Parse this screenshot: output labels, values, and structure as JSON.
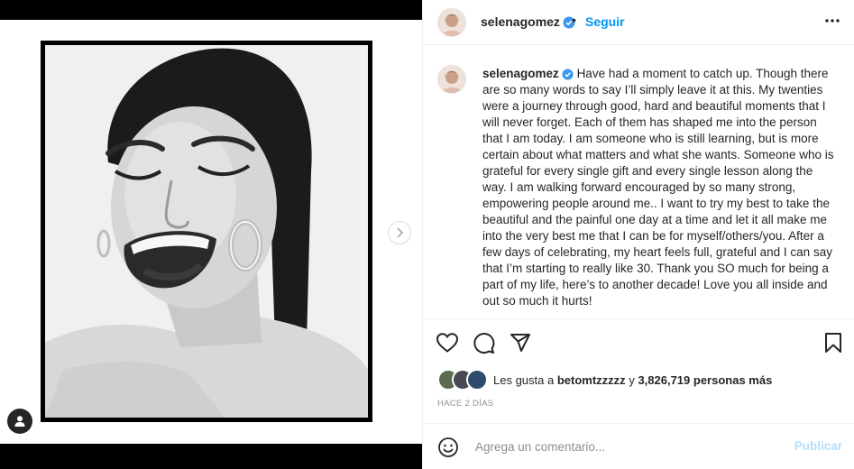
{
  "post": {
    "username": "selenagomez",
    "dot": "•",
    "follow_label": "Seguir",
    "caption": "Have had a moment to catch up. Though there are so many words to say I’ll simply leave it at this. My twenties were a journey through good, hard and beautiful moments that I will never forget. Each of them has shaped me into the person that I am today. I am someone who is still learning, but is more certain about what matters and what she wants. Someone who is grateful for every single gift and every single lesson along the way. I am walking forward encouraged by so many strong, empowering people around me.. I want to try my best to take the beautiful and the painful one day at a time and let it all make me into the very best me that I can be for myself/others/you. After a few days of celebrating, my heart feels full, grateful and I can say that I’m starting to really like 30. Thank you SO much for being a part of my life, here’s to another decade! Love you all inside and out so much it hurts!",
    "likes": {
      "prefix": "Les gusta a",
      "user": "betomtzzzzz",
      "conjunction": "y",
      "count": "3,826,719 personas más"
    },
    "time": "HACE 2 DÍAS"
  },
  "comment": {
    "placeholder": "Agrega un comentario...",
    "publish_label": "Publicar"
  },
  "icons": {
    "next": "chevron-right-icon",
    "tag": "user-icon",
    "more": "more-horizontal-icon",
    "like": "heart-icon",
    "comment": "comment-icon",
    "share": "send-icon",
    "save": "bookmark-icon",
    "emoji": "smiley-icon"
  },
  "colors": {
    "link": "#0095f6",
    "verified": "#3897f0",
    "publish_disabled": "#b2dffc",
    "muted": "#8e8e8e"
  }
}
